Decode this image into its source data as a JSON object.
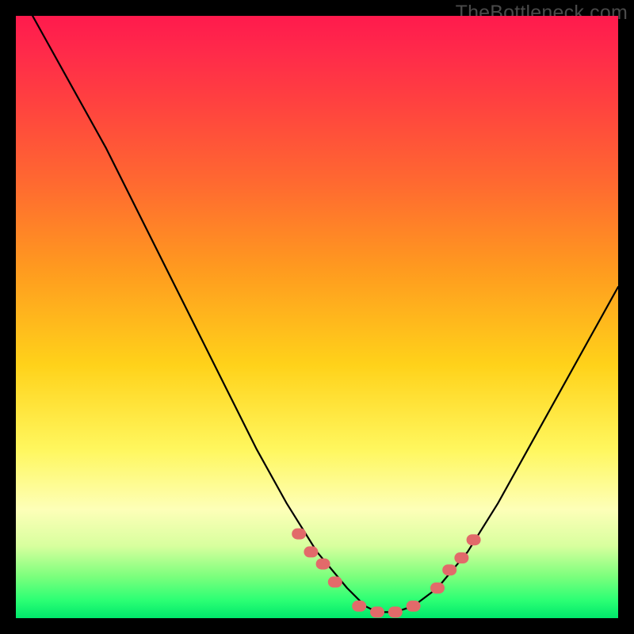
{
  "watermark": "TheBottleneck.com",
  "colors": {
    "curve_stroke": "#000000",
    "marker_fill": "#e26a6a",
    "marker_stroke": "#d85f5f"
  },
  "chart_data": {
    "type": "line",
    "title": "",
    "xlabel": "",
    "ylabel": "",
    "xlim": [
      0,
      100
    ],
    "ylim": [
      0,
      100
    ],
    "series": [
      {
        "name": "bottleneck-curve",
        "x": [
          0,
          5,
          10,
          15,
          20,
          25,
          30,
          35,
          40,
          45,
          50,
          55,
          58,
          60,
          63,
          66,
          70,
          75,
          80,
          85,
          90,
          95,
          100
        ],
        "y": [
          105,
          96,
          87,
          78,
          68,
          58,
          48,
          38,
          28,
          19,
          11,
          5,
          2,
          1,
          1,
          2,
          5,
          11,
          19,
          28,
          37,
          46,
          55
        ]
      }
    ],
    "markers": {
      "name": "highlight-dots",
      "x": [
        47,
        49,
        51,
        53,
        57,
        60,
        63,
        66,
        70,
        72,
        74,
        76
      ],
      "y": [
        14,
        11,
        9,
        6,
        2,
        1,
        1,
        2,
        5,
        8,
        10,
        13
      ]
    }
  }
}
